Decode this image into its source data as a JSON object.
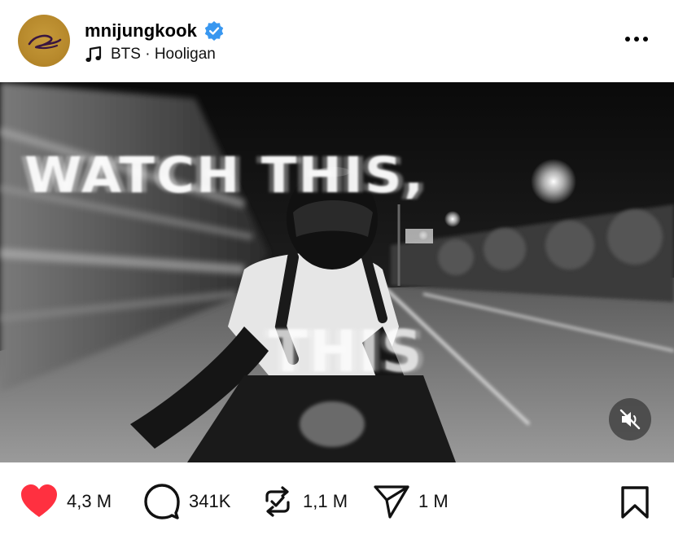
{
  "post": {
    "author": {
      "username": "mnijungkook",
      "verified": true,
      "avatar_icon": "gold-signature-avatar"
    },
    "music": {
      "icon": "music-note-icon",
      "label": "BTS · Hooligan"
    },
    "menu_icon": "more-horizontal-icon"
  },
  "media": {
    "overlay_line_1": "WATCH THIS,",
    "overlay_line_2": "THIS",
    "mute_icon": "speaker-muted-icon"
  },
  "actions": {
    "like": {
      "icon": "heart-icon",
      "count": "4,3 M",
      "liked": true,
      "color": "#ff3040"
    },
    "comment": {
      "icon": "comment-bubble-icon",
      "count": "341K"
    },
    "repost": {
      "icon": "repost-icon",
      "count": "1,1 M"
    },
    "share": {
      "icon": "send-icon",
      "count": "1 M"
    },
    "save": {
      "icon": "bookmark-icon"
    }
  },
  "colors": {
    "verified_badge": "#3897f0",
    "avatar_gold": "#b7892c",
    "like_red": "#ff3040"
  }
}
